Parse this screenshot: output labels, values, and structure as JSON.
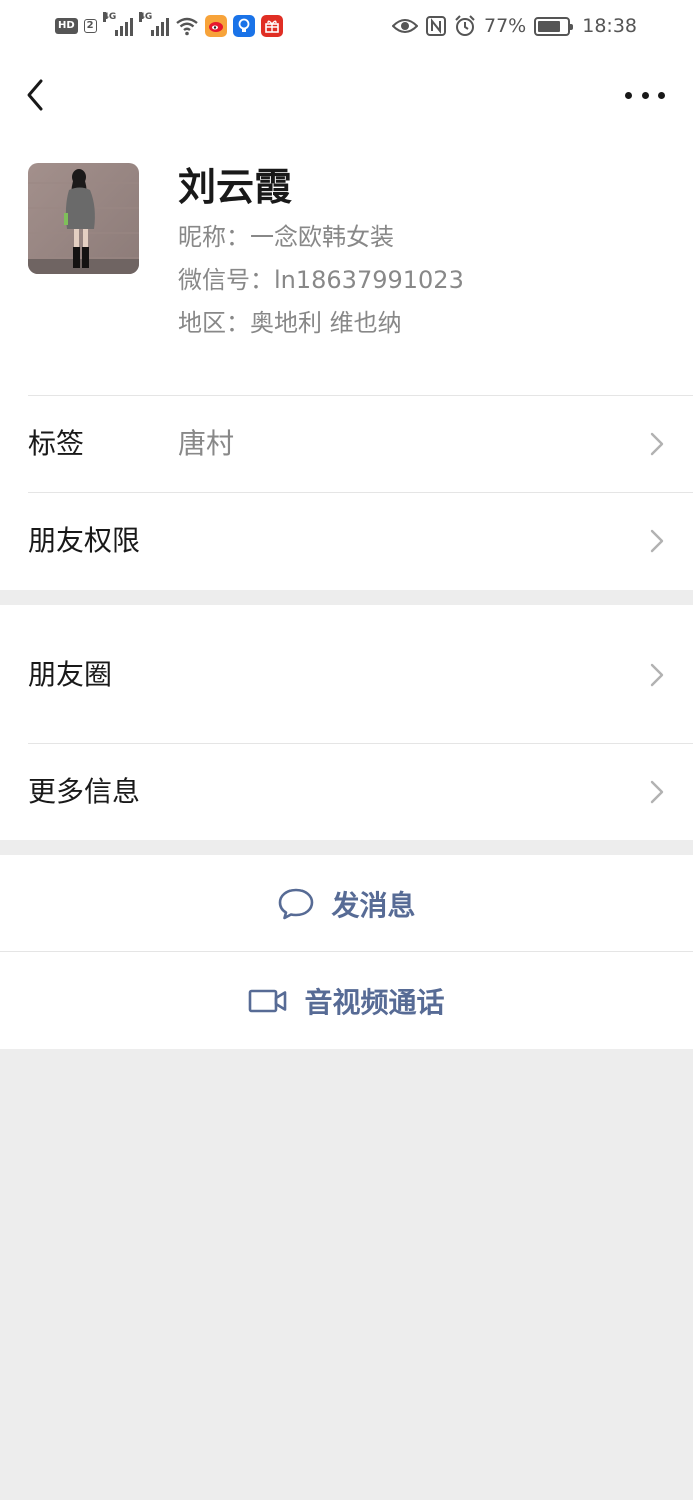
{
  "status_bar": {
    "hd_label": "HD",
    "sim_label": "2",
    "network_1": "4G",
    "network_2": "4G",
    "battery_percent": "77%",
    "battery_level": 0.77,
    "time": "18:38",
    "icons": [
      "signal-icon",
      "wifi-icon",
      "weibo-app-icon",
      "bulb-app-icon",
      "gift-app-icon",
      "eye-icon",
      "nfc-icon",
      "alarm-icon",
      "battery-icon"
    ]
  },
  "nav": {
    "back_icon": "chevron-left-icon",
    "more_icon": "more-dots-icon"
  },
  "profile": {
    "name": "刘云霞",
    "nickname": "昵称：一念欧韩女装",
    "wechat_id": "微信号：ln18637991023",
    "region": "地区：奥地利  维也纳"
  },
  "rows": {
    "tags_label": "标签",
    "tags_value": "唐村",
    "permissions_label": "朋友权限",
    "moments_label": "朋友圈",
    "more_info_label": "更多信息"
  },
  "actions": {
    "message_label": "发消息",
    "call_label": "音视频通话"
  },
  "colors": {
    "accent_link": "#576b95",
    "background": "#ededed",
    "card": "#ffffff",
    "secondary_text": "#888888"
  }
}
